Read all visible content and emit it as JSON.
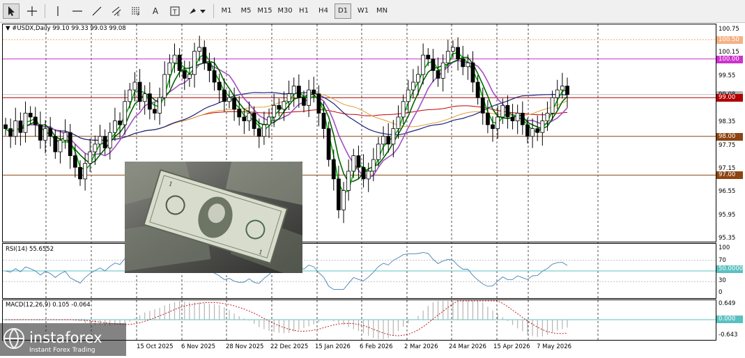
{
  "toolbar": {
    "tools": [
      "cursor-icon",
      "crosshair-icon",
      "vertical-line-icon",
      "horizontal-line-icon",
      "trendline-icon",
      "equidistant-channel-icon",
      "fibonacci-icon",
      "text-icon",
      "text-label-icon",
      "arrows-icon"
    ],
    "text_tool_label": "A",
    "timeframes": [
      "M1",
      "M5",
      "M15",
      "M30",
      "H1",
      "H4",
      "D1",
      "W1",
      "MN"
    ],
    "selected_timeframe": "D1"
  },
  "main_panel": {
    "header": "▼ #USDX,Daily  99.10 99.33 99.03 99.08",
    "price_ticks": [
      "100.75",
      "100.15",
      "99.55",
      "98.95",
      "98.35",
      "97.75",
      "97.15",
      "96.55",
      "95.95",
      "95.35"
    ],
    "level_tags": [
      {
        "text": "100.50",
        "price": 100.5,
        "bg": "#f4b183",
        "color": "#ffffff",
        "line": "#f4a460",
        "style": "dotted"
      },
      {
        "text": "100.00",
        "price": 100.0,
        "bg": "#cc33cc",
        "color": "#ffffff",
        "line": "#cc33cc",
        "style": "solid"
      },
      {
        "text": "99.08",
        "price": 99.08,
        "bg": "#b3b3b3",
        "color": "#000000",
        "line": "#c0c0c0",
        "style": "solid"
      },
      {
        "text": "99.00",
        "price": 99.0,
        "bg": "#b00000",
        "color": "#ffffff",
        "line": "#b00000",
        "style": "solid"
      },
      {
        "text": "98.00",
        "price": 98.0,
        "bg": "#8b4513",
        "color": "#ffffff",
        "line": "#8b4513",
        "style": "solid"
      },
      {
        "text": "97.00",
        "price": 97.0,
        "bg": "#8b4513",
        "color": "#ffffff",
        "line": "#8b4513",
        "style": "solid"
      }
    ]
  },
  "rsi_panel": {
    "header": "RSI(14) 55.6552",
    "ticks": [
      "100",
      "70",
      "50",
      "30",
      "0"
    ],
    "level_tag": "50.0000"
  },
  "macd_panel": {
    "header": "MACD(12,26,9) 0.105 -0.064",
    "ticks": [
      "0.649",
      "-0.643"
    ],
    "level_tag": "0.000"
  },
  "date_axis": [
    "15 Oct 2025",
    "6 Nov 2025",
    "28 Nov 2025",
    "22 Dec 2025",
    "15 Jan 2026",
    "6 Feb 2026",
    "2 Mar 2026",
    "24 Mar 2026",
    "15 Apr 2026",
    "7 May 2026"
  ],
  "logo": {
    "brand": "instaforex",
    "tagline": "Instant Forex Trading"
  },
  "colors": {
    "up_candle": "#ffffff",
    "down_candle": "#000000",
    "ma_green": "#00b000",
    "ma_dark_green": "#006400",
    "ma_violet": "#a050c0",
    "ma_navy": "#1a237e",
    "ma_orange": "#e0a030",
    "ma_red": "#c00000",
    "indicator_line": "#4682b4",
    "macd_hist": "#b4b4b4",
    "macd_signal": "#c00000"
  },
  "chart_data": {
    "type": "candlestick",
    "symbol": "#USDX",
    "timeframe": "Daily",
    "series_close": [
      98.2,
      98.0,
      98.4,
      98.1,
      98.6,
      98.5,
      98.3,
      97.9,
      98.2,
      98.0,
      97.6,
      97.9,
      98.1,
      97.5,
      97.2,
      96.9,
      97.3,
      97.6,
      97.8,
      98.0,
      97.7,
      98.1,
      98.4,
      98.3,
      98.9,
      99.2,
      99.4,
      98.9,
      99.1,
      98.7,
      98.6,
      99.0,
      99.6,
      99.9,
      100.1,
      99.7,
      99.5,
      99.6,
      100.2,
      100.3,
      99.9,
      99.7,
      99.4,
      99.2,
      98.9,
      99.0,
      98.7,
      98.5,
      98.4,
      98.6,
      98.2,
      98.0,
      98.3,
      98.5,
      98.8,
      98.7,
      98.9,
      99.1,
      99.3,
      99.0,
      98.8,
      99.2,
      99.1,
      98.6,
      98.2,
      97.4,
      96.9,
      96.1,
      96.6,
      97.1,
      97.5,
      97.2,
      96.9,
      97.1,
      97.4,
      97.8,
      98.0,
      97.8,
      98.2,
      98.5,
      98.9,
      99.2,
      99.4,
      99.6,
      100.1,
      100.0,
      99.7,
      99.5,
      99.9,
      100.2,
      100.3,
      100.0,
      99.8,
      99.9,
      99.4,
      99.0,
      98.6,
      98.3,
      98.2,
      98.5,
      98.8,
      98.5,
      98.4,
      98.6,
      98.3,
      98.0,
      98.2,
      98.1,
      98.4,
      98.6,
      99.0,
      99.2,
      99.3,
      99.08
    ],
    "rsi_value": 55.6552,
    "macd": [
      0.105,
      -0.064
    ]
  }
}
